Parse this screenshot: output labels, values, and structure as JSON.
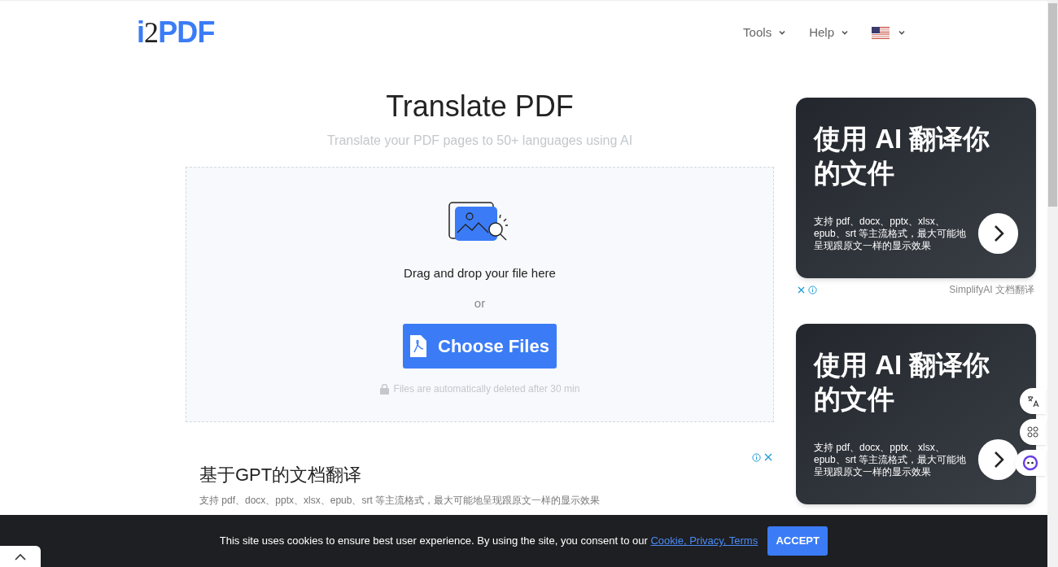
{
  "header": {
    "logo": [
      "i",
      "2",
      "PDF"
    ],
    "nav": [
      {
        "label": "Tools",
        "kind": "text"
      },
      {
        "label": "Help",
        "kind": "text"
      },
      {
        "kind": "flag"
      }
    ]
  },
  "main": {
    "title": "Translate PDF",
    "subtitle": "Translate your PDF pages to 50+ languages using AI",
    "drop_text": "Drag and drop your file here",
    "or": "or",
    "button": "Choose Files",
    "note": "Files are automatically deleted after 30 min"
  },
  "inline_ad": {
    "title": "基于GPT的文档翻译",
    "text": "支持 pdf、docx、pptx、xlsx、epub、srt 等主流格式，最大可能地呈现跟原文一样的显示效果"
  },
  "side_ads": [
    {
      "title": "使用 AI 翻译你的文件",
      "text": "支持 pdf、docx、pptx、xlsx、epub、srt 等主流格式，最大可能地呈现跟原文一样的显示效果",
      "sponsor": "SimplifyAI 文档翻译"
    },
    {
      "title": "使用 AI 翻译你的文件",
      "text": "支持 pdf、docx、pptx、xlsx、epub、srt 等主流格式，最大可能地呈现跟原文一样的显示效果"
    }
  ],
  "cookie": {
    "text": "This site uses cookies to ensure best user experience. By using the site, you consent to our",
    "link": "Cookie, Privacy, Terms",
    "button": "ACCEPT"
  }
}
